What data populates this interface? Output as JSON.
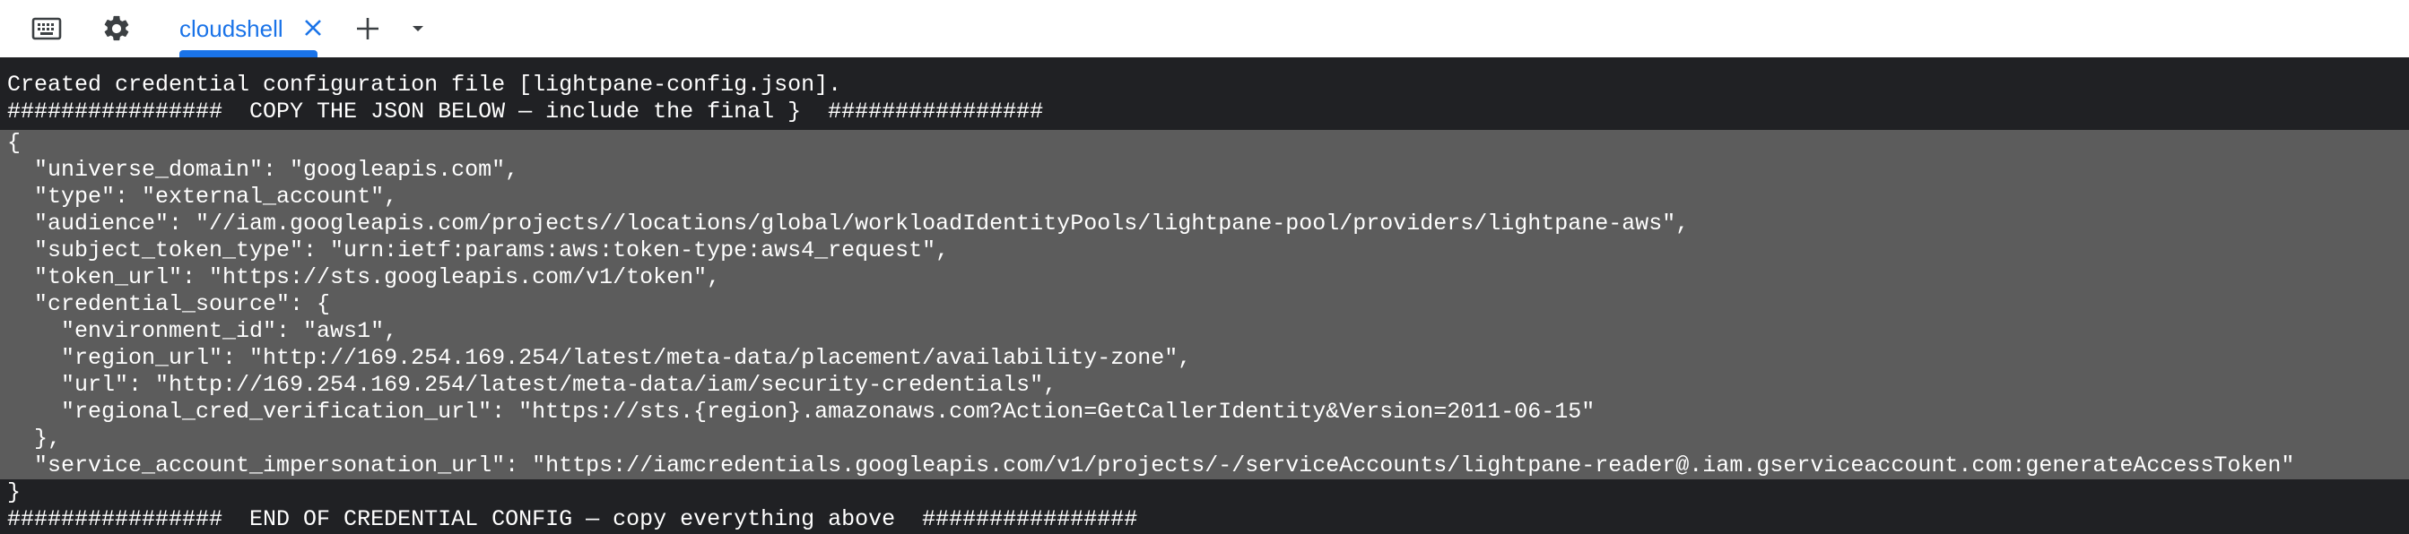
{
  "toolbar": {
    "keyboard_icon": "keyboard-icon",
    "settings_icon": "gear-icon",
    "add_icon": "plus-icon",
    "dropdown_icon": "chevron-down-icon"
  },
  "tab": {
    "label": "cloudshell",
    "close_icon": "close-icon"
  },
  "colors": {
    "accent": "#1a73e8",
    "terminal_bg": "#202124",
    "selection_bg": "#5c5c5c",
    "text": "#ffffff"
  },
  "terminal": {
    "lines": [
      "Created credential configuration file [lightpane-config.json].",
      "################  COPY THE JSON BELOW — include the final }  ################",
      "{",
      "  \"universe_domain\": \"googleapis.com\",",
      "  \"type\": \"external_account\",",
      "  \"audience\": \"//iam.googleapis.com/projects//locations/global/workloadIdentityPools/lightpane-pool/providers/lightpane-aws\",",
      "  \"subject_token_type\": \"urn:ietf:params:aws:token-type:aws4_request\",",
      "  \"token_url\": \"https://sts.googleapis.com/v1/token\",",
      "  \"credential_source\": {",
      "    \"environment_id\": \"aws1\",",
      "    \"region_url\": \"http://169.254.169.254/latest/meta-data/placement/availability-zone\",",
      "    \"url\": \"http://169.254.169.254/latest/meta-data/iam/security-credentials\",",
      "    \"regional_cred_verification_url\": \"https://sts.{region}.amazonaws.com?Action=GetCallerIdentity&Version=2011-06-15\"",
      "  },",
      "  \"service_account_impersonation_url\": \"https://iamcredentials.googleapis.com/v1/projects/-/serviceAccounts/lightpane-reader@.iam.gserviceaccount.com:generateAccessToken\"",
      "}",
      "################  END OF CREDENTIAL CONFIG — copy everything above  ################"
    ]
  }
}
